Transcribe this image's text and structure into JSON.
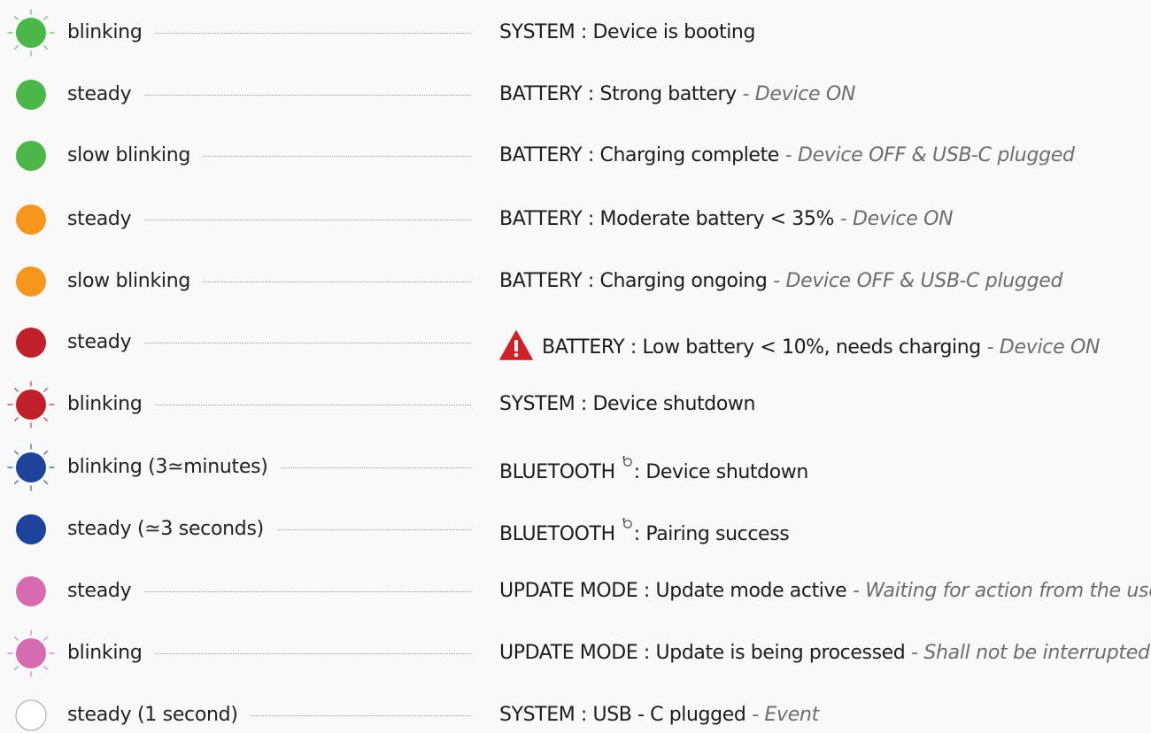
{
  "colors": {
    "green": "#4bb749",
    "orange": "#f7961d",
    "red": "#c0202a",
    "blue": "#1d439c",
    "pink": "#d66bb0",
    "white": "#ffffff",
    "warning": "#d02028"
  },
  "rows": [
    {
      "led_color": "green",
      "led_mode": "blinking",
      "state": "blinking",
      "category": "SYSTEM",
      "separator": " : ",
      "text": "Device is booting",
      "note": ""
    },
    {
      "led_color": "green",
      "led_mode": "steady",
      "state": "steady",
      "category": "BATTERY",
      "separator": " : ",
      "text": "Strong battery",
      "note": " - Device ON"
    },
    {
      "led_color": "green",
      "led_mode": "slow-blinking",
      "state": "slow blinking",
      "category": "BATTERY",
      "separator": " : ",
      "text": "Charging complete",
      "note": " - Device OFF & USB-C plugged"
    },
    {
      "led_color": "orange",
      "led_mode": "steady",
      "state": "steady",
      "category": "BATTERY",
      "separator": " : ",
      "text": "Moderate battery < 35%",
      "note": " - Device ON"
    },
    {
      "led_color": "orange",
      "led_mode": "slow-blinking",
      "state": "slow blinking",
      "category": "BATTERY",
      "separator": " : ",
      "text": "Charging ongoing",
      "note": " - Device OFF & USB-C plugged"
    },
    {
      "led_color": "red",
      "led_mode": "steady",
      "state": "steady",
      "category": "BATTERY",
      "separator": " : ",
      "text": "Low battery < 10%, needs charging",
      "note": " - Device ON",
      "warning_icon": "warning-triangle-icon"
    },
    {
      "led_color": "red",
      "led_mode": "blinking",
      "state": "blinking",
      "category": "SYSTEM",
      "separator": " : ",
      "text": "Device shutdown",
      "note": ""
    },
    {
      "led_color": "blue",
      "led_mode": "blinking",
      "state": "blinking (3≃minutes)",
      "category": "BLUETOOTH",
      "separator": ": ",
      "text": "Device shutdown",
      "note": "",
      "bluetooth_icon": "bluetooth-icon"
    },
    {
      "led_color": "blue",
      "led_mode": "steady",
      "state": "steady (≃3 seconds)",
      "category": "BLUETOOTH",
      "separator": ": ",
      "text": "Pairing success",
      "note": "",
      "bluetooth_icon": "bluetooth-icon"
    },
    {
      "led_color": "pink",
      "led_mode": "steady",
      "state": "steady",
      "category": "UPDATE MODE",
      "separator": " : ",
      "text": "Update mode active",
      "note": " - Waiting for action from the user"
    },
    {
      "led_color": "pink",
      "led_mode": "blinking",
      "state": "blinking",
      "category": "UPDATE MODE",
      "separator": " : ",
      "text": "Update is being processed",
      "note": " - Shall not be interrupted"
    },
    {
      "led_color": "white",
      "led_mode": "steady",
      "state": "steady (1 second)",
      "category": "SYSTEM",
      "separator": " : ",
      "text": "USB - C plugged",
      "note": " - Event"
    }
  ]
}
